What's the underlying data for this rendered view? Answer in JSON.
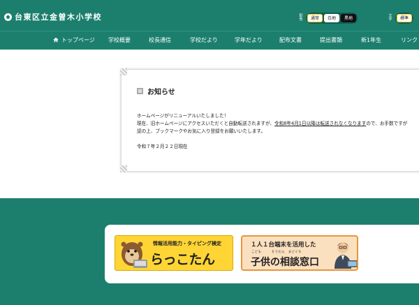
{
  "header": {
    "school_name": "台東区立金曽木小学校",
    "color_label": "配色",
    "color_options": [
      "通常",
      "白地",
      "黒地"
    ],
    "font_label": "文字",
    "font_options": [
      "標準"
    ]
  },
  "nav": {
    "items": [
      "トップページ",
      "学校概要",
      "校長通信",
      "学校だより",
      "学年だより",
      "配布文書",
      "提出書類",
      "新1年生",
      "リンク"
    ]
  },
  "notice": {
    "title": "お知らせ",
    "line1": "ホームページがリニューアルいたしました！",
    "line2_pre": "現在、旧ホームページにアクセスいただくと自動転送されますが、",
    "line2_link": "令和8年4月1日以降は転送されなくなります",
    "line2_post": "ので、お手数ですが",
    "line3": "認の上、ブックマークやお気に入り登録をお願いいたします。",
    "date": "令和７年２月２２日現在"
  },
  "banners": {
    "rakkotan_sub": "情報活用能力・タイピング検定",
    "rakkotan_main": "らっこたん",
    "soudan_top": "１人１台端末を活用した",
    "soudan_ruby": "こども　　　そうだん　まどぐち",
    "soudan_main": "子供の相談窓口"
  },
  "colors": {
    "brand_green": "#1c7f6e",
    "banner_yellow": "#ffd535",
    "banner_orange": "#e8953a"
  }
}
